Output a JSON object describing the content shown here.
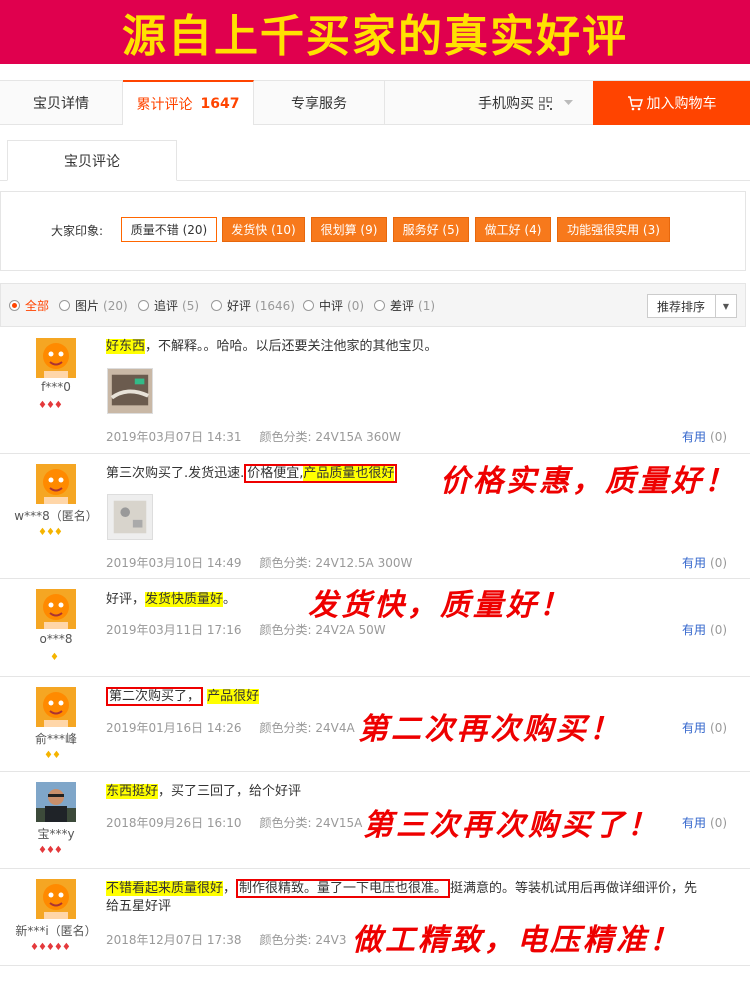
{
  "banner": {
    "title": "源自上千买家的真实好评"
  },
  "tabs": [
    {
      "label": "宝贝详情"
    },
    {
      "label": "累计评论",
      "count": "1647"
    },
    {
      "label": "专享服务"
    },
    {
      "label": "手机购买"
    }
  ],
  "cart": {
    "label": "加入购物车"
  },
  "subtab": {
    "label": "宝贝评论"
  },
  "impression": {
    "label": "大家印象:",
    "tags": [
      "质量不错 (20)",
      "发货快 (10)",
      "很划算 (9)",
      "服务好 (5)",
      "做工好 (4)",
      "功能强很实用 (3)"
    ]
  },
  "filters": [
    {
      "label": "全部",
      "count": ""
    },
    {
      "label": "图片",
      "count": "(20)"
    },
    {
      "label": "追评",
      "count": "(5)"
    },
    {
      "label": "好评",
      "count": "(1646)"
    },
    {
      "label": "中评",
      "count": "(0)"
    },
    {
      "label": "差评",
      "count": "(1)"
    }
  ],
  "sort": {
    "label": "推荐排序"
  },
  "reviews": [
    {
      "user": "f***0",
      "date": "2019年03月07日 14:31",
      "spec": "颜色分类: 24V15A 360W",
      "useful": "有用",
      "useful_count": "(0)",
      "seg": [
        "好东西",
        "，不解释。。哈哈。以后还要关注他家的其他宝贝。"
      ]
    },
    {
      "user": "w***8（匿名）",
      "date": "2019年03月10日 14:49",
      "spec": "颜色分类: 24V12.5A 300W",
      "useful": "有用",
      "useful_count": "(0)",
      "seg": [
        "第三次购买了.发货迅速.",
        "价格便宜,",
        "产品质量也很好"
      ],
      "annotation": "价格实惠，质量好！"
    },
    {
      "user": "o***8",
      "date": "2019年03月11日 17:16",
      "spec": "颜色分类: 24V2A 50W",
      "useful": "有用",
      "useful_count": "(0)",
      "seg": [
        "好评，",
        "发货快质量好",
        "。"
      ],
      "annotation": "发货快，质量好！"
    },
    {
      "user": "俞***峰",
      "date": "2019年01月16日 14:26",
      "spec": "颜色分类: 24V4A",
      "useful": "有用",
      "useful_count": "(0)",
      "seg": [
        "第二次购买了，",
        "产品很好"
      ],
      "annotation": "第二次再次购买！"
    },
    {
      "user": "宝***y",
      "date": "2018年09月26日 16:10",
      "spec": "颜色分类: 24V15A",
      "useful": "有用",
      "useful_count": "(0)",
      "seg": [
        "东西挺好",
        "，买了三回了，给个好评"
      ],
      "annotation": "第三次再次购买了！"
    },
    {
      "user": "新***i（匿名）",
      "date": "2018年12月07日 17:38",
      "spec": "颜色分类: 24V3",
      "useful": "有用",
      "useful_count": "(0)",
      "seg": [
        "不错看起来质量很好",
        "，",
        "制作很精致。量了一下电压也很准。",
        "挺满意的。等装机试用后再做详细评价，先",
        "给五星好评"
      ],
      "annotation": "做工精致，电压精准！"
    }
  ],
  "colors": {
    "banner": "#e0004e",
    "banner_text": "#ffe100",
    "accent": "#ff4400",
    "tag": "#f7791c",
    "annotation": "#ee0000",
    "highlight": "#ffff00"
  }
}
